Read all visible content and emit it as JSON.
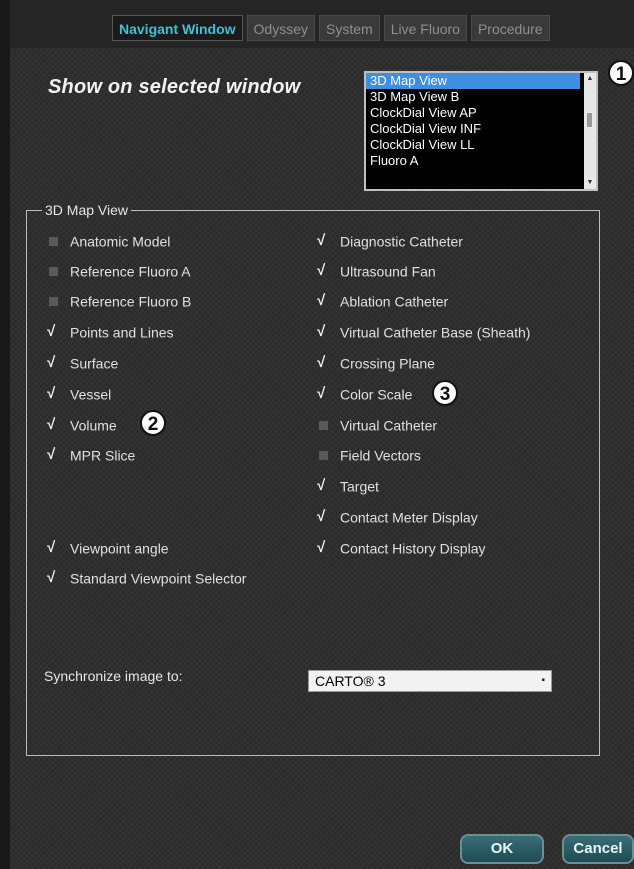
{
  "tabs": [
    {
      "label": "Navigant Window",
      "active": true
    },
    {
      "label": "Odyssey",
      "active": false
    },
    {
      "label": "System",
      "active": false
    },
    {
      "label": "Live Fluoro",
      "active": false
    },
    {
      "label": "Procedure",
      "active": false
    }
  ],
  "show_on_label": "Show on selected window",
  "window_list": {
    "items": [
      "3D Map View",
      "3D Map View B",
      "ClockDial View AP",
      "ClockDial View INF",
      "ClockDial View LL",
      "Fluoro A"
    ],
    "selected": "3D Map View"
  },
  "markers": {
    "m1": "1",
    "m2": "2",
    "m3": "3"
  },
  "group": {
    "title": "3D Map View",
    "left_options": [
      {
        "label": "Anatomic Model",
        "checked": false
      },
      {
        "label": "Reference Fluoro A",
        "checked": false
      },
      {
        "label": "Reference Fluoro B",
        "checked": false
      },
      {
        "label": "Points and Lines",
        "checked": true
      },
      {
        "label": "Surface",
        "checked": true
      },
      {
        "label": "Vessel",
        "checked": true
      },
      {
        "label": "Volume",
        "checked": true
      },
      {
        "label": "MPR Slice",
        "checked": true
      },
      {
        "label": "Viewpoint angle",
        "checked": true
      },
      {
        "label": "Standard Viewpoint Selector",
        "checked": true
      }
    ],
    "right_options": [
      {
        "label": "Diagnostic Catheter",
        "checked": true
      },
      {
        "label": "Ultrasound Fan",
        "checked": true
      },
      {
        "label": "Ablation Catheter",
        "checked": true
      },
      {
        "label": "Virtual Catheter Base (Sheath)",
        "checked": true
      },
      {
        "label": "Crossing Plane",
        "checked": true
      },
      {
        "label": "Color Scale",
        "checked": true
      },
      {
        "label": "Virtual Catheter",
        "checked": false
      },
      {
        "label": "Field Vectors",
        "checked": false
      },
      {
        "label": "Target",
        "checked": true
      },
      {
        "label": "Contact Meter Display",
        "checked": true
      },
      {
        "label": "Contact History Display",
        "checked": true
      }
    ]
  },
  "sync": {
    "label": "Synchronize image to:",
    "value": "CARTO® 3"
  },
  "buttons": {
    "ok": "OK",
    "cancel": "Cancel"
  }
}
